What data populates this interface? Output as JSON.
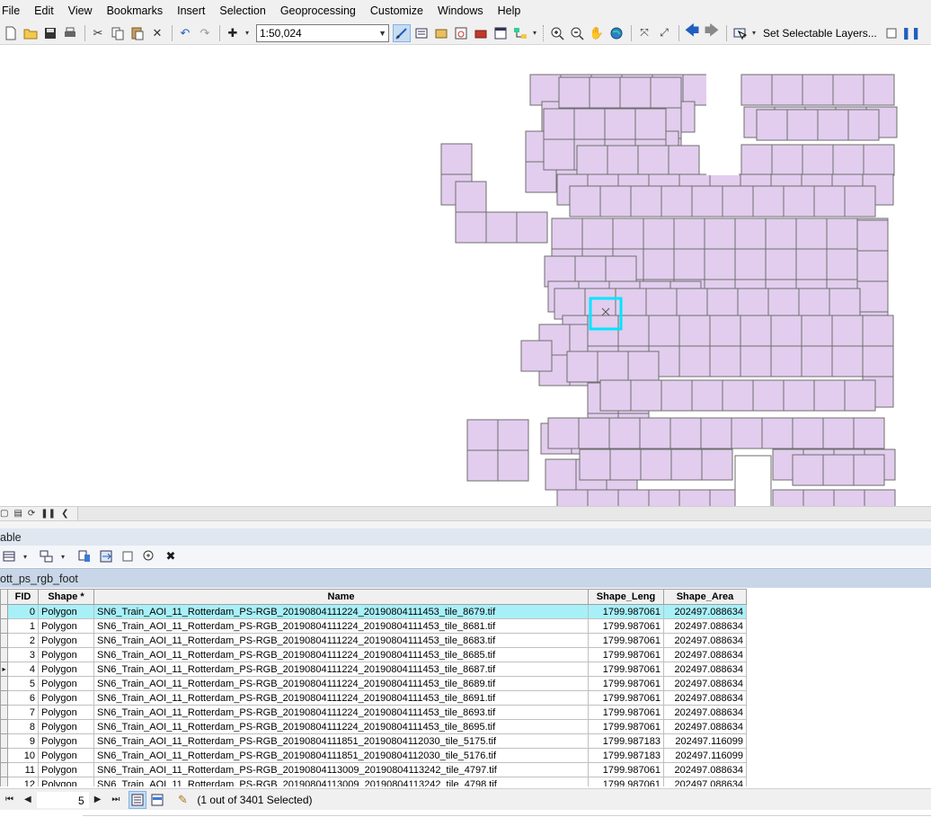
{
  "menu": [
    "File",
    "Edit",
    "View",
    "Bookmarks",
    "Insert",
    "Selection",
    "Geoprocessing",
    "Customize",
    "Windows",
    "Help"
  ],
  "toolbar": {
    "scale": "1:50,024",
    "selectable_layers_label": "Set Selectable Layers..."
  },
  "colors": {
    "tile_fill": "#e2cdee",
    "tile_stroke": "#6e6e6e",
    "selection_outline": "#00e5ff",
    "selected_row": "#a8f0f8"
  },
  "table_window": {
    "title": "able",
    "layer_tab": "ott_ps_rgb_foot",
    "columns": [
      "FID",
      "Shape *",
      "Name",
      "Shape_Leng",
      "Shape_Area"
    ],
    "rows": [
      {
        "fid": "0",
        "shape": "Polygon",
        "name": "SN6_Train_AOI_11_Rotterdam_PS-RGB_20190804111224_20190804111453_tile_8679.tif",
        "leng": "1799.987061",
        "area": "202497.088634"
      },
      {
        "fid": "1",
        "shape": "Polygon",
        "name": "SN6_Train_AOI_11_Rotterdam_PS-RGB_20190804111224_20190804111453_tile_8681.tif",
        "leng": "1799.987061",
        "area": "202497.088634"
      },
      {
        "fid": "2",
        "shape": "Polygon",
        "name": "SN6_Train_AOI_11_Rotterdam_PS-RGB_20190804111224_20190804111453_tile_8683.tif",
        "leng": "1799.987061",
        "area": "202497.088634"
      },
      {
        "fid": "3",
        "shape": "Polygon",
        "name": "SN6_Train_AOI_11_Rotterdam_PS-RGB_20190804111224_20190804111453_tile_8685.tif",
        "leng": "1799.987061",
        "area": "202497.088634"
      },
      {
        "fid": "4",
        "shape": "Polygon",
        "name": "SN6_Train_AOI_11_Rotterdam_PS-RGB_20190804111224_20190804111453_tile_8687.tif",
        "leng": "1799.987061",
        "area": "202497.088634"
      },
      {
        "fid": "5",
        "shape": "Polygon",
        "name": "SN6_Train_AOI_11_Rotterdam_PS-RGB_20190804111224_20190804111453_tile_8689.tif",
        "leng": "1799.987061",
        "area": "202497.088634"
      },
      {
        "fid": "6",
        "shape": "Polygon",
        "name": "SN6_Train_AOI_11_Rotterdam_PS-RGB_20190804111224_20190804111453_tile_8691.tif",
        "leng": "1799.987061",
        "area": "202497.088634"
      },
      {
        "fid": "7",
        "shape": "Polygon",
        "name": "SN6_Train_AOI_11_Rotterdam_PS-RGB_20190804111224_20190804111453_tile_8693.tif",
        "leng": "1799.987061",
        "area": "202497.088634"
      },
      {
        "fid": "8",
        "shape": "Polygon",
        "name": "SN6_Train_AOI_11_Rotterdam_PS-RGB_20190804111224_20190804111453_tile_8695.tif",
        "leng": "1799.987061",
        "area": "202497.088634"
      },
      {
        "fid": "9",
        "shape": "Polygon",
        "name": "SN6_Train_AOI_11_Rotterdam_PS-RGB_20190804111851_20190804112030_tile_5175.tif",
        "leng": "1799.987183",
        "area": "202497.116099"
      },
      {
        "fid": "10",
        "shape": "Polygon",
        "name": "SN6_Train_AOI_11_Rotterdam_PS-RGB_20190804111851_20190804112030_tile_5176.tif",
        "leng": "1799.987183",
        "area": "202497.116099"
      },
      {
        "fid": "11",
        "shape": "Polygon",
        "name": "SN6_Train_AOI_11_Rotterdam_PS-RGB_20190804113009_20190804113242_tile_4797.tif",
        "leng": "1799.987061",
        "area": "202497.088634"
      },
      {
        "fid": "12",
        "shape": "Polygon",
        "name": "SN6_Train_AOI_11_Rotterdam_PS-RGB_20190804113009_20190804113242_tile_4798.tif",
        "leng": "1799.987061",
        "area": "202497.088634"
      }
    ],
    "selected_row_index": 0,
    "current_row_index": 4
  },
  "navigation": {
    "current_record": "5",
    "selection_status": "(1 out of 3401 Selected)"
  }
}
